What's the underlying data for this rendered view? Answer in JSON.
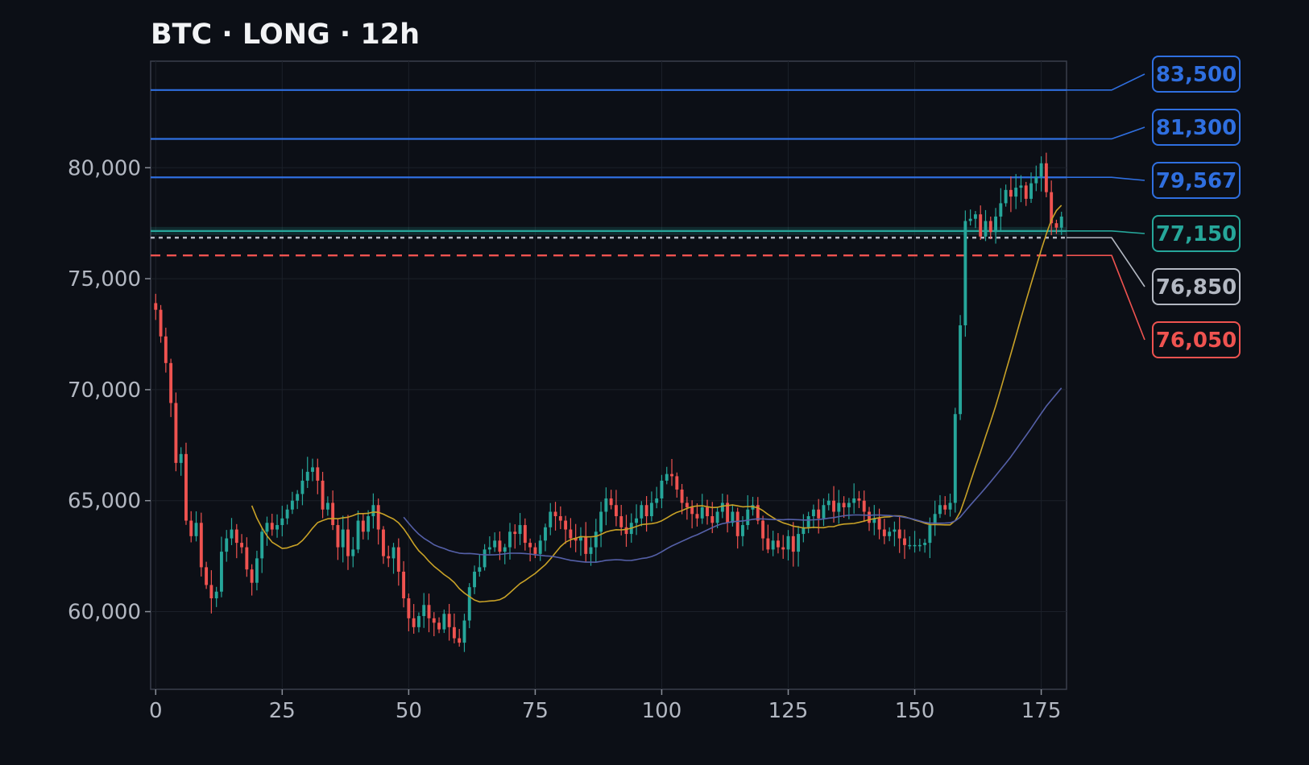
{
  "chart_data": {
    "type": "candlestick",
    "title": "BTC · LONG · 12h",
    "xlabel": "",
    "ylabel": "",
    "xlim": [
      -1,
      180
    ],
    "ylim": [
      56500,
      84800
    ],
    "x_ticks": [
      0,
      25,
      50,
      75,
      100,
      125,
      150,
      175
    ],
    "x_tick_labels": [
      "0",
      "25",
      "50",
      "75",
      "100",
      "125",
      "150",
      "175"
    ],
    "y_ticks": [
      60000,
      65000,
      70000,
      75000,
      80000
    ],
    "y_tick_labels": [
      "60,000",
      "65,000",
      "70,000",
      "75,000",
      "80,000"
    ],
    "grid": true,
    "colors": {
      "background": "#0c0f16",
      "up": "#26a69a",
      "down": "#ef5350",
      "ma_fast": "#c9a227",
      "ma_slow": "#5560a8",
      "target": "#2f6fe0",
      "entry": "#26a69a",
      "breakeven": "#b3b8c2",
      "stop": "#ef5350"
    },
    "candles": {
      "start_x": 0,
      "close": [
        73600,
        72400,
        71200,
        69400,
        66700,
        67100,
        64100,
        63400,
        64000,
        62000,
        61200,
        60600,
        60900,
        62700,
        63300,
        63700,
        63100,
        62900,
        61900,
        61300,
        62400,
        63600,
        64000,
        63700,
        63900,
        64200,
        64600,
        65000,
        65300,
        65900,
        66300,
        66500,
        65900,
        64600,
        64900,
        63900,
        62900,
        63700,
        62500,
        62800,
        64100,
        63600,
        64300,
        64800,
        63700,
        62500,
        62400,
        62900,
        61800,
        60600,
        59700,
        59300,
        59800,
        60300,
        59700,
        59500,
        59200,
        59900,
        59300,
        58800,
        58600,
        59600,
        61100,
        61800,
        62000,
        62800,
        62900,
        63200,
        62700,
        62900,
        63600,
        63500,
        63900,
        63100,
        62900,
        62600,
        63200,
        63800,
        64500,
        64300,
        64100,
        63700,
        63300,
        63200,
        63400,
        62600,
        62900,
        63600,
        64500,
        65100,
        64800,
        64300,
        63800,
        63500,
        64000,
        64200,
        64800,
        64300,
        64900,
        65100,
        65900,
        66200,
        66100,
        65500,
        64900,
        64700,
        64400,
        64200,
        64700,
        64300,
        64000,
        64500,
        64900,
        64000,
        64500,
        63400,
        63900,
        64600,
        64800,
        64100,
        63300,
        62800,
        63200,
        62900,
        62800,
        63400,
        62700,
        63500,
        63800,
        64300,
        64600,
        64200,
        64800,
        65000,
        64500,
        64900,
        64700,
        64900,
        65100,
        65000,
        64500,
        64000,
        64200,
        63700,
        63400,
        63600,
        63700,
        63300,
        63000,
        63000,
        63000,
        63000,
        63100,
        63900,
        64400,
        64800,
        64600,
        64900,
        68900,
        72900,
        77600,
        77700,
        77900,
        76900,
        77600,
        77100,
        77800,
        78400,
        79000,
        78700,
        79100,
        79200,
        78600,
        79300,
        79600,
        80200,
        78900,
        77500,
        77300,
        77800
      ],
      "open_first": 73900
    },
    "moving_averages": [
      {
        "period": 20,
        "color_key": "ma_fast",
        "width": 1.6
      },
      {
        "period": 50,
        "color_key": "ma_slow",
        "width": 1.6
      }
    ],
    "levels": [
      {
        "value": 83500,
        "label": "83,500",
        "color_key": "target",
        "style": "solid"
      },
      {
        "value": 81300,
        "label": "81,300",
        "color_key": "target",
        "style": "solid"
      },
      {
        "value": 79567,
        "label": "79,567",
        "color_key": "target",
        "style": "solid"
      },
      {
        "value": 77150,
        "label": "77,150",
        "color_key": "entry",
        "style": "solid"
      },
      {
        "value": 76850,
        "label": "76,850",
        "color_key": "breakeven",
        "style": "dotted"
      },
      {
        "value": 76050,
        "label": "76,050",
        "color_key": "stop",
        "style": "dashed"
      }
    ]
  }
}
